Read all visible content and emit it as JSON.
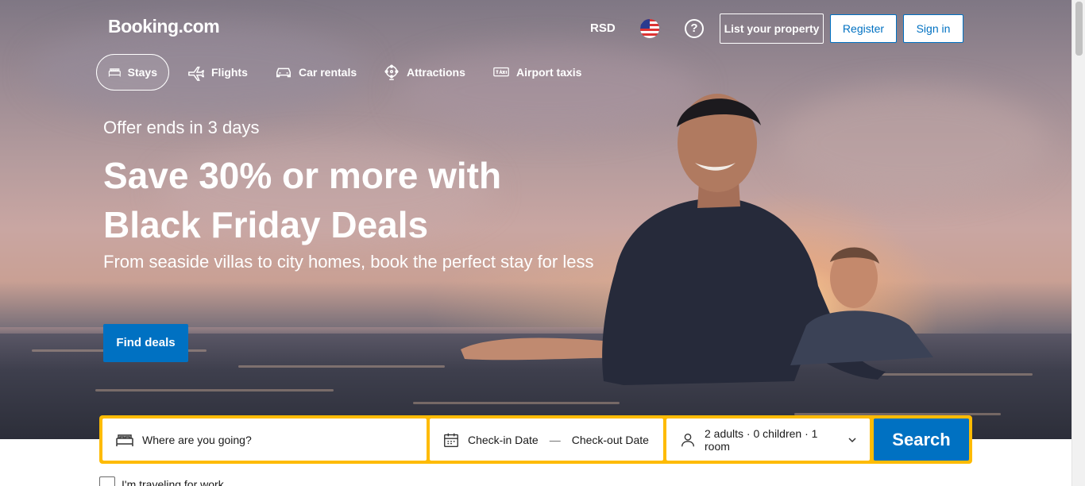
{
  "header": {
    "logo": "Booking.com",
    "currency": "RSD",
    "help_label": "?",
    "list_property_label": "List your property",
    "register_label": "Register",
    "signin_label": "Sign in"
  },
  "nav": {
    "tabs": [
      {
        "label": "Stays",
        "icon": "bed-icon",
        "active": true
      },
      {
        "label": "Flights",
        "icon": "airplane-icon",
        "active": false
      },
      {
        "label": "Car rentals",
        "icon": "car-icon",
        "active": false
      },
      {
        "label": "Attractions",
        "icon": "ferris-wheel-icon",
        "active": false
      },
      {
        "label": "Airport taxis",
        "icon": "taxi-icon",
        "active": false
      }
    ]
  },
  "hero": {
    "offer": "Offer ends in 3 days",
    "headline_line1": "Save 30% or more with",
    "headline_line2": "Black Friday Deals",
    "subtext": "From seaside villas to city homes, book the perfect stay for less",
    "cta_label": "Find deals"
  },
  "search": {
    "destination_placeholder": "Where are you going?",
    "checkin_label": "Check-in Date",
    "checkout_label": "Check-out Date",
    "date_separator": "—",
    "guests_label": "2 adults · 0 children · 1 room",
    "search_label": "Search",
    "work_travel_label": "I'm traveling for work"
  },
  "colors": {
    "brand_blue": "#0071c2",
    "search_border_yellow": "#febb02",
    "text_white": "#ffffff"
  }
}
